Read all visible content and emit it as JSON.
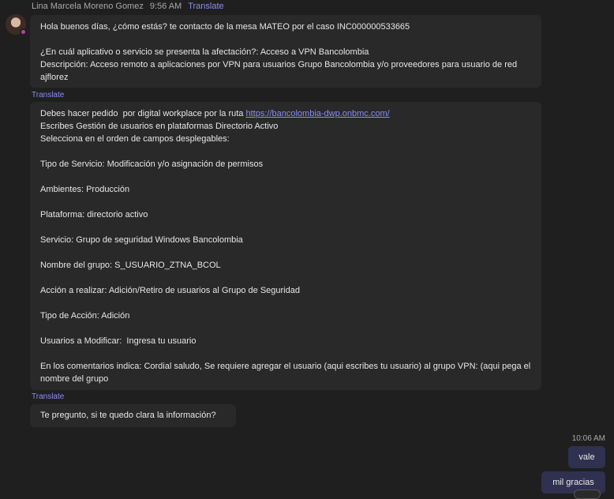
{
  "message1": {
    "sender": "Lina Marcela Moreno Gomez",
    "time": "9:56 AM",
    "translate": "Translate",
    "lines": [
      "Hola buenos días, ¿cómo estás? te contacto de la mesa MATEO por el caso INC000000533665",
      "",
      "¿En cuál aplicativo o servicio se presenta la afectación?: Acceso a VPN Bancolombia",
      "Descripción: Acceso remoto a aplicaciones por VPN para usuarios Grupo Bancolombia y/o proveedores para usuario de red ajflorez"
    ]
  },
  "message2": {
    "translate": "Translate",
    "intro": "Debes hacer pedido  por digital workplace por la ruta ",
    "link": "https://bancolombia-dwp.onbmc.com/",
    "lines": [
      "Escribes Gestión de usuarios en plataformas Directorio Activo",
      "Selecciona en el orden de campos desplegables:",
      "",
      "Tipo de Servicio: Modificación y/o asignación de permisos",
      "",
      "Ambientes: Producción",
      "",
      "Plataforma: directorio activo",
      "",
      "Servicio: Grupo de seguridad Windows Bancolombia",
      "",
      "Nombre del grupo: S_USUARIO_ZTNA_BCOL",
      "",
      "Acción a realizar: Adición/Retiro de usuarios al Grupo de Seguridad",
      "",
      "Tipo de Acción: Adición",
      "",
      "Usuarios a Modificar:  Ingresa tu usuario",
      "",
      "En los comentarios indica: Cordial saludo, Se requiere agregar el usuario (aqui escribes tu usuario) al grupo VPN: (aqui pega el nombre del grupo"
    ]
  },
  "message3": {
    "translate": "Translate",
    "text": "Te pregunto, si te quedo clara la información?"
  },
  "my_messages": {
    "time": "10:06 AM",
    "msg1": "vale",
    "msg2": "mil gracias"
  },
  "colors": {
    "background": "#1f1f1f",
    "bubble": "#292929",
    "my_bubble": "#303050",
    "accent": "#8b8ef0"
  }
}
